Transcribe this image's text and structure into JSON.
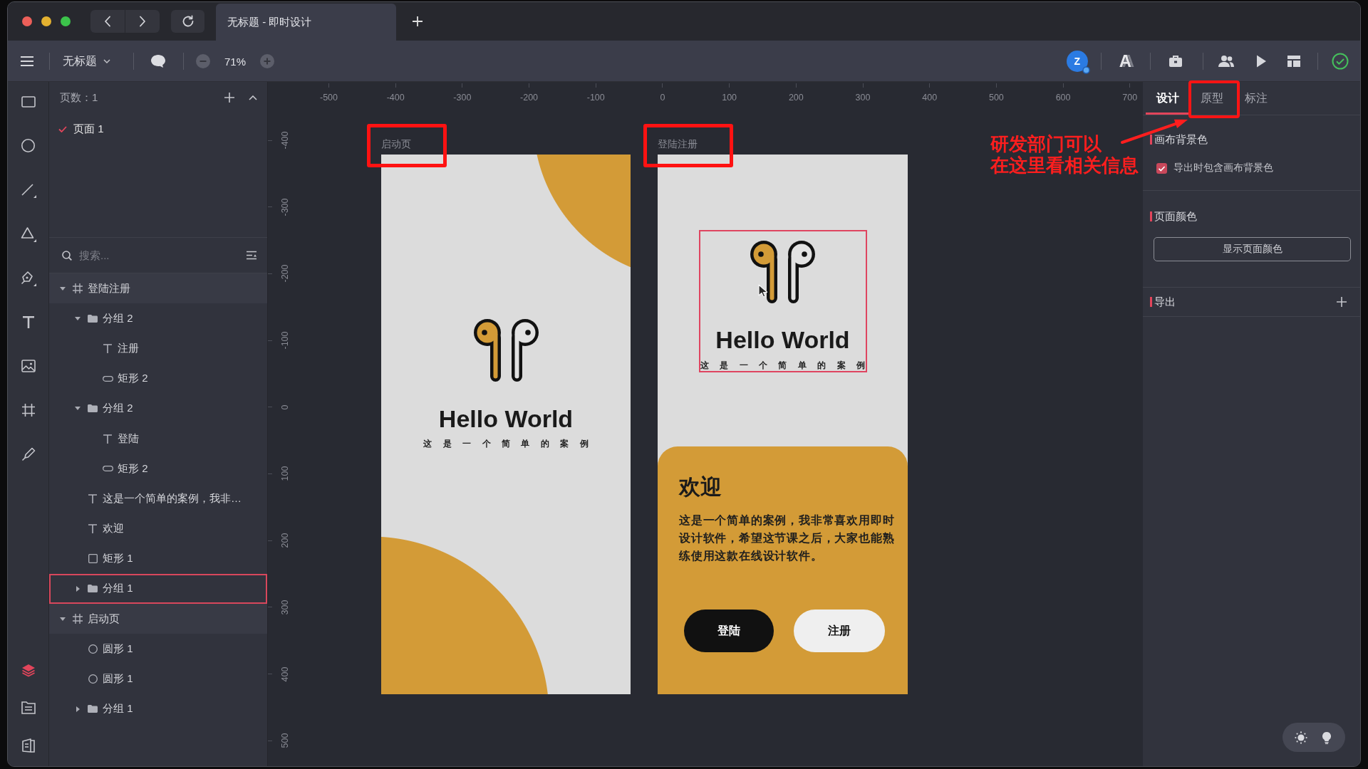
{
  "window": {
    "tab_title": "无标题 - 即时设计"
  },
  "toolbar": {
    "file_name": "无标题",
    "zoom": "71%",
    "avatar_letter": "Z",
    "font_button": "A"
  },
  "tool_rail": {
    "panel_switcher": [
      {
        "selected": true
      },
      {
        "selected": false
      },
      {
        "selected": false
      }
    ]
  },
  "pages": {
    "count_label": "页数：1",
    "items": [
      {
        "name": "页面 1",
        "selected": true
      }
    ]
  },
  "layers": {
    "search_placeholder": "搜索...",
    "tree": [
      {
        "name": "登陆注册",
        "kind": "artboard",
        "expanded": true,
        "selected": false,
        "children": [
          {
            "name": "分组 2",
            "kind": "group",
            "expanded": true,
            "selected": false,
            "children": [
              {
                "name": "注册",
                "kind": "text",
                "selected": false
              },
              {
                "name": "矩形 2",
                "kind": "pill",
                "selected": false
              }
            ]
          },
          {
            "name": "分组 2",
            "kind": "group",
            "expanded": true,
            "selected": false,
            "children": [
              {
                "name": "登陆",
                "kind": "text",
                "selected": false
              },
              {
                "name": "矩形 2",
                "kind": "pill",
                "selected": false
              }
            ]
          },
          {
            "name": "这是一个简单的案例，我非…",
            "kind": "text",
            "selected": false
          },
          {
            "name": "欢迎",
            "kind": "text",
            "selected": false
          },
          {
            "name": "矩形 1",
            "kind": "rectangle",
            "selected": false
          },
          {
            "name": "分组 1",
            "kind": "group",
            "expanded": false,
            "selected": true
          }
        ]
      },
      {
        "name": "启动页",
        "kind": "artboard",
        "expanded": true,
        "selected": false,
        "children": [
          {
            "name": "圆形 1",
            "kind": "ellipse",
            "selected": false
          },
          {
            "name": "圆形 1",
            "kind": "ellipse",
            "selected": false
          },
          {
            "name": "分组 1",
            "kind": "group",
            "expanded": false,
            "selected": false
          }
        ]
      }
    ]
  },
  "canvas": {
    "x_ticks": [
      "-500",
      "-400",
      "-300",
      "-200",
      "-100",
      "0",
      "100",
      "200",
      "300",
      "400",
      "500",
      "600",
      "700"
    ],
    "y_ticks": [
      "-400",
      "-300",
      "-200",
      "-100",
      "0",
      "100",
      "200",
      "300",
      "400",
      "500"
    ],
    "artboards": [
      {
        "label": "启动页",
        "highlighted": true,
        "kind": "splash",
        "logo": {
          "title": "Hello World",
          "subtitle": "这 是 一 个 简 单 的 案 例"
        }
      },
      {
        "label": "登陆注册",
        "highlighted": true,
        "kind": "welcome",
        "logo": {
          "title": "Hello World",
          "subtitle": "这 是 一 个 简 单 的 案 例",
          "selected": true
        },
        "card": {
          "heading": "欢迎",
          "body": "这是一个简单的案例，我非常喜欢用即时设计软件，希望这节课之后，大家也能熟练使用这款在线设计软件。",
          "buttons": [
            {
              "label": "登陆",
              "kind": "primary"
            },
            {
              "label": "注册",
              "kind": "secondary"
            }
          ]
        }
      }
    ]
  },
  "inspector": {
    "tabs": [
      {
        "label": "设计",
        "selected": true,
        "highlighted": false
      },
      {
        "label": "原型",
        "selected": false,
        "highlighted": true
      },
      {
        "label": "标注",
        "selected": false,
        "highlighted": false
      }
    ],
    "sections": [
      {
        "kind": "checkbox",
        "title": "画布背景色",
        "option": {
          "label": "导出时包含画布背景色",
          "checked": true
        }
      },
      {
        "kind": "button",
        "title": "页面颜色",
        "button": "显示页面颜色"
      },
      {
        "kind": "add",
        "title": "导出"
      }
    ]
  },
  "callout": {
    "lines": [
      "研发部门可以",
      "在这里看相关信息"
    ]
  }
}
